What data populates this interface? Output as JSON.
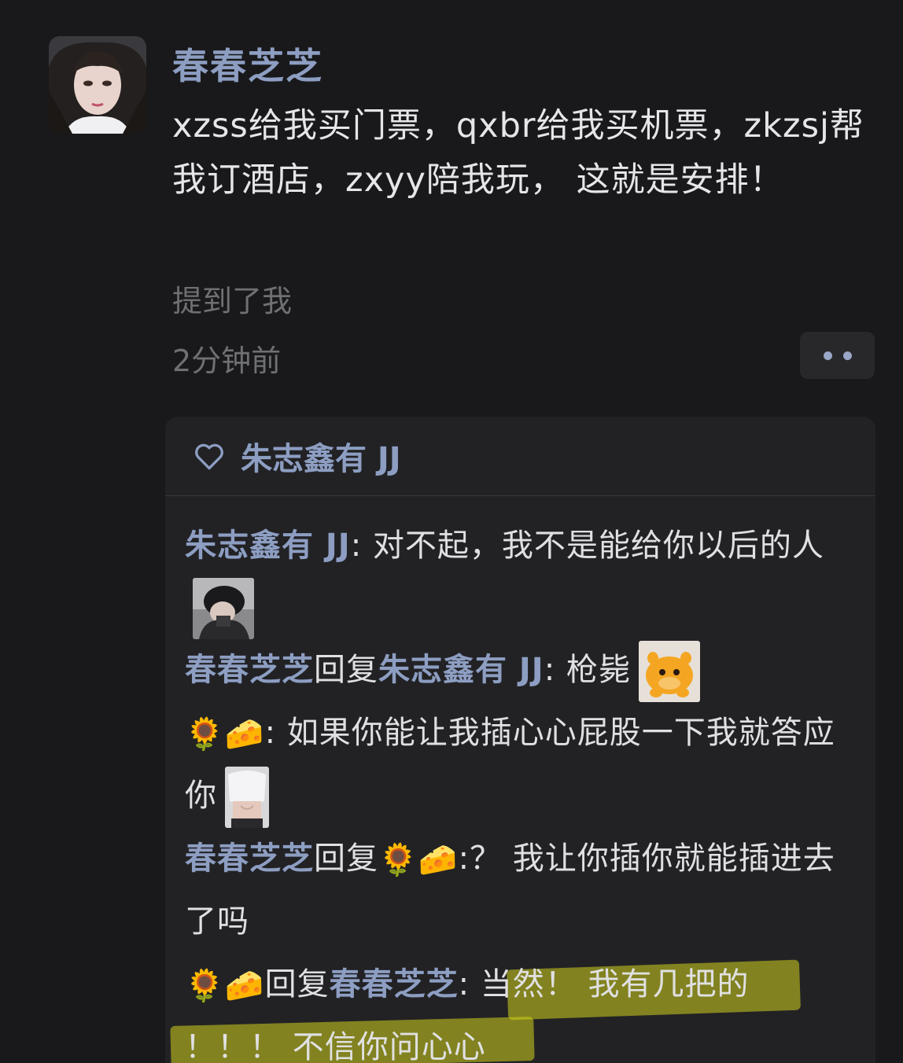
{
  "post": {
    "author": "春春芝芝",
    "text": "xzss给我买门票，qxbr给我买机票，zkzsj帮我订酒店，zxyy陪我玩， 这就是安排！",
    "mention": "提到了我",
    "time": "2分钟前"
  },
  "likes": {
    "user": "朱志鑫有 JJ"
  },
  "comments": [
    {
      "name": "朱志鑫有 JJ",
      "sep": ": ",
      "text": "对不起，我不是能给你以后的人"
    },
    {
      "name": "春春芝芝",
      "reply": "回复",
      "target": "朱志鑫有 JJ",
      "sep": ": ",
      "text": "枪毙"
    },
    {
      "emoji": "🌻🧀",
      "sep": ": ",
      "text": "如果你能让我插心心屁股一下我就答应你"
    },
    {
      "name": "春春芝芝",
      "reply": "回复",
      "target_emoji": "🌻🧀",
      "sep": ":",
      "text": "？ 我让你插你就能插进去了吗"
    },
    {
      "emoji": "🌻🧀",
      "reply": "回复",
      "target": "春春芝芝",
      "sep": ": ",
      "text_a": "当然！ 我有几把的",
      "text_b": "！！！ 不信你问心心"
    }
  ],
  "colors": {
    "background": "#19191b",
    "card": "#222225",
    "name": "#8d9ec2",
    "highlight": "#d2d21e"
  }
}
